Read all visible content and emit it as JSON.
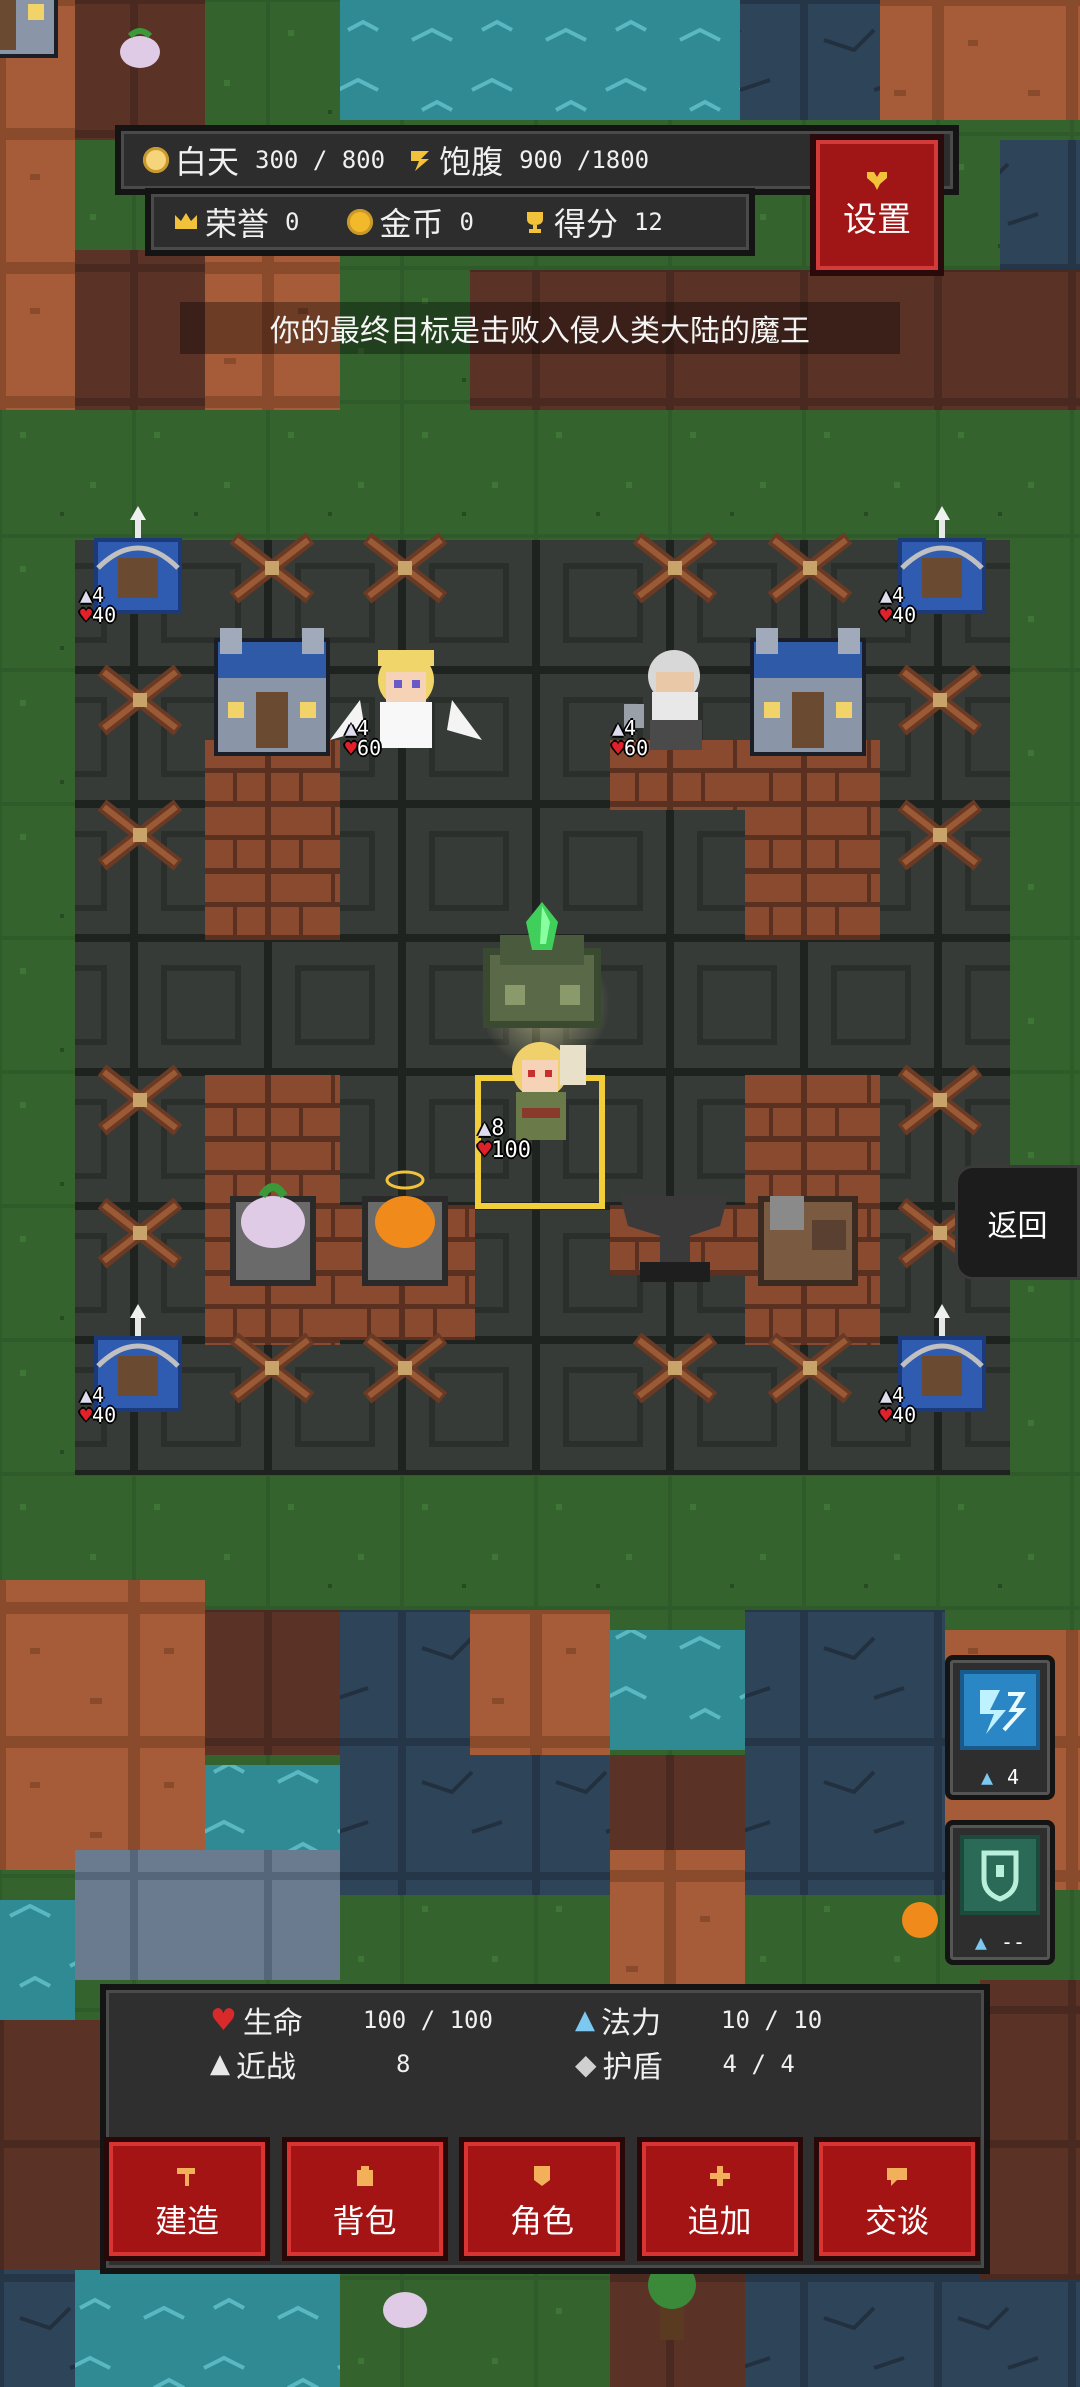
{
  "hud": {
    "day": {
      "label": "白天",
      "value": "300 / 800"
    },
    "satiety": {
      "label": "饱腹",
      "value": "900 /1800"
    },
    "honor": {
      "label": "荣誉",
      "value": "0"
    },
    "gold": {
      "label": "金币",
      "value": "0"
    },
    "score": {
      "label": "得分",
      "value": "12"
    },
    "settings_label": "设置"
  },
  "goal_text": "你的最终目标是击败入侵人类大陆的魔王",
  "units": {
    "turret": {
      "attack": "4",
      "hp": "40"
    },
    "angel": {
      "attack": "4",
      "hp": "60"
    },
    "elder": {
      "attack": "4",
      "hp": "60"
    },
    "hero": {
      "attack": "8",
      "hp": "100"
    }
  },
  "back_label": "返回",
  "skills": [
    {
      "icon": "lightning-skill-icon",
      "count": "4"
    },
    {
      "icon": "shield-skill-icon",
      "count": "--"
    }
  ],
  "stats": {
    "life": {
      "label": "生命",
      "value": "100 / 100"
    },
    "mana": {
      "label": "法力",
      "value": "10 /  10"
    },
    "melee": {
      "label": "近战",
      "value": "8"
    },
    "shield": {
      "label": "护盾",
      "value": "4 /  4"
    }
  },
  "actions": [
    {
      "label": "建造",
      "icon": "hammer-icon"
    },
    {
      "label": "背包",
      "icon": "bag-icon"
    },
    {
      "label": "角色",
      "icon": "character-icon"
    },
    {
      "label": "追加",
      "icon": "plus-icon"
    },
    {
      "label": "交谈",
      "icon": "talk-icon"
    }
  ],
  "colors": {
    "button_red": "#a41414",
    "panel_dark": "#2f2f2f",
    "grass": "#2f5a2a",
    "dirt": "#a8603a"
  }
}
